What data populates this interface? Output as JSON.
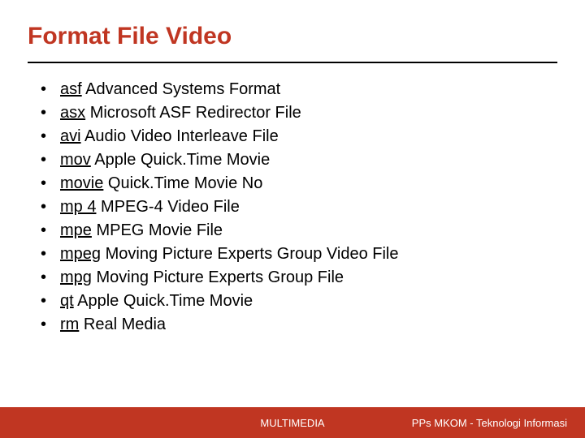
{
  "title": "Format File Video",
  "formats": [
    {
      "ext": "asf",
      "desc": "Advanced Systems Format"
    },
    {
      "ext": "asx",
      "desc": "Microsoft ASF Redirector File"
    },
    {
      "ext": "avi",
      "desc": "Audio Video Interleave File"
    },
    {
      "ext": "mov",
      "desc": "Apple Quick.Time Movie"
    },
    {
      "ext": "movie",
      "desc": "Quick.Time Movie No"
    },
    {
      "ext": "mp 4",
      "desc": "MPEG-4 Video File"
    },
    {
      "ext": "mpe",
      "desc": "MPEG Movie File"
    },
    {
      "ext": "mpeg",
      "desc": "Moving Picture Experts Group Video File"
    },
    {
      "ext": "mpg",
      "desc": "Moving Picture Experts Group File"
    },
    {
      "ext": "qt",
      "desc": "Apple Quick.Time Movie"
    },
    {
      "ext": "rm",
      "desc": "Real Media"
    }
  ],
  "footer": {
    "center": "MULTIMEDIA",
    "right": "PPs MKOM - Teknologi Informasi"
  }
}
